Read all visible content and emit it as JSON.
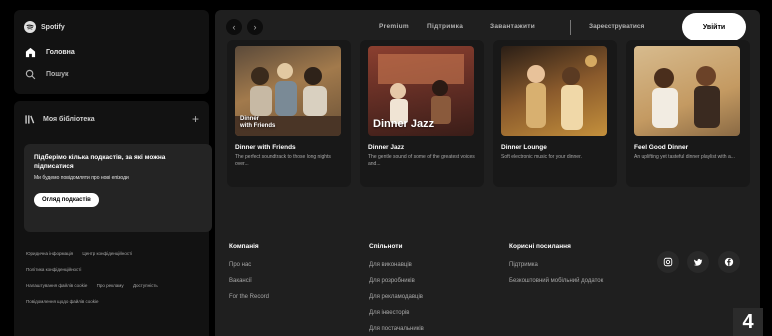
{
  "app": {
    "logo_text": "Spotify"
  },
  "sidebar": {
    "nav": [
      {
        "label": "Головна",
        "icon": "home-icon"
      },
      {
        "label": "Пошук",
        "icon": "search-icon"
      }
    ],
    "library": {
      "title": "Моя бібліотека",
      "add_symbol": "+",
      "card_title": "Підберімо кілька подкастів, за які можна підписатися",
      "card_subtitle": "Ми будемо повідомляти про нові епізоди",
      "card_button": "Огляд подкастів"
    },
    "legal_links": [
      "Юридична інформація",
      "Центр конфіденційності",
      "Політика конфіденційності",
      "Налаштування файлів cookie",
      "Про рекламу",
      "Доступність",
      "Повідомлення щодо файлів cookie"
    ]
  },
  "topbar": {
    "back_symbol": "‹",
    "forward_symbol": "›",
    "links": [
      "Premium",
      "Підтримка",
      "Завантажити"
    ],
    "signup": "Зареєструватися",
    "login": "Увійти"
  },
  "cards": [
    {
      "name": "Dinner with Friends",
      "description": "The perfect soundtrack to those long nights over...",
      "art_overlay_line1": "Dinner",
      "art_overlay_line2": "with Friends"
    },
    {
      "name": "Dinner Jazz",
      "description": "The gentle sound of some of the greatest voices and...",
      "art_overlay_line1": "Dinner Jazz",
      "art_overlay_line2": ""
    },
    {
      "name": "Dinner Lounge",
      "description": "Soft electronic music for your dinner.",
      "art_overlay_line1": "",
      "art_overlay_line2": ""
    },
    {
      "name": "Feel Good Dinner",
      "description": "An uplifting yet tasteful dinner playlist with a...",
      "art_overlay_line1": "",
      "art_overlay_line2": ""
    }
  ],
  "footer": {
    "columns": [
      {
        "heading": "Компанія",
        "links": [
          "Про нас",
          "Вакансії",
          "For the Record"
        ]
      },
      {
        "heading": "Спільноти",
        "links": [
          "Для виконавців",
          "Для розробників",
          "Для рекламодавців",
          "Для інвесторів",
          "Для постачальників"
        ]
      },
      {
        "heading": "Корисні посилання",
        "links": [
          "Підтримка",
          "Безкоштовний мобільний додаток"
        ]
      }
    ],
    "social_icons": [
      "instagram-icon",
      "twitter-icon",
      "facebook-icon"
    ]
  },
  "corner_badge": "4",
  "colors": {
    "app_bg": "#000000",
    "panel_bg": "#121212",
    "main_bg": "#1f1f1f",
    "card_bg": "#181818",
    "text_muted": "#a7a7a7",
    "art_friends": "#8a6a44",
    "art_jazz": "#6b3a2e",
    "art_lounge": "#b07a3c",
    "art_feelgood": "#c9a070"
  }
}
